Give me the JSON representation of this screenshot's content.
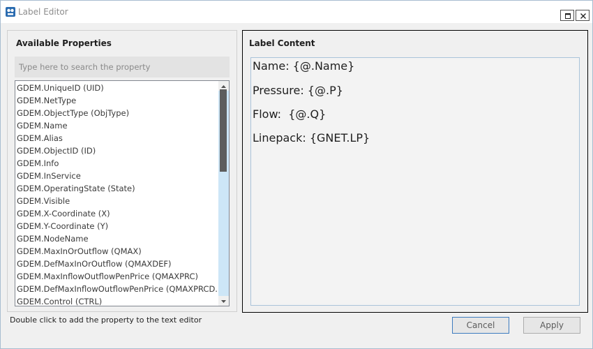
{
  "window": {
    "title": "Label Editor",
    "icon": "app-logo-icon",
    "controls": {
      "maximize": "maximize-icon",
      "close": "close-icon"
    }
  },
  "left_panel": {
    "title": "Available Properties",
    "search_placeholder": "Type here to search the property",
    "items": [
      "GDEM.UniqueID (UID)",
      "GDEM.NetType",
      "GDEM.ObjectType (ObjType)",
      "GDEM.Name",
      "GDEM.Alias",
      "GDEM.ObjectID (ID)",
      "GDEM.Info",
      "GDEM.InService",
      "GDEM.OperatingState (State)",
      "GDEM.Visible",
      "GDEM.X-Coordinate (X)",
      "GDEM.Y-Coordinate (Y)",
      "GDEM.NodeName",
      "GDEM.MaxInOrOutflow (QMAX)",
      "GDEM.DefMaxInOrOutflow (QMAXDEF)",
      "GDEM.MaxInflowOutflowPenPrice (QMAXPRC)",
      "GDEM.DefMaxInflowOutflowPenPrice  (QMAXPRCD...",
      "GDEM.Control (CTRL)"
    ],
    "hint": "Double click to add the property to the text editor"
  },
  "right_panel": {
    "title": "Label Content",
    "lines": [
      "Name: {@.Name}",
      "Pressure: {@.P}",
      "Flow:  {@.Q}",
      "Linepack: {GNET.LP}"
    ]
  },
  "buttons": {
    "cancel": "Cancel",
    "apply": "Apply"
  },
  "colors": {
    "scrollbar_track": "#cde6f7",
    "scrollbar_thumb": "#5d5d5d",
    "focus_border": "#3d7bbf"
  }
}
